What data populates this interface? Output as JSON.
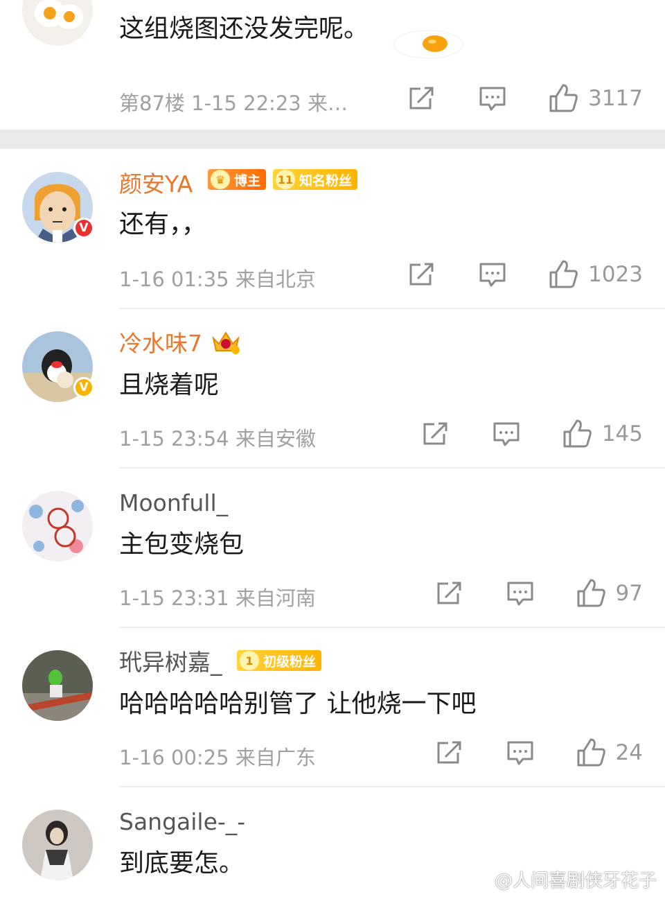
{
  "comments": [
    {
      "text": "这组烧图还没发完呢。",
      "meta": "第87楼 1-15 22:23 来…",
      "likes": "3117"
    },
    {
      "username": "颜安YA",
      "badge_blogger": "博主",
      "badge_fan_level": "11",
      "badge_fan": "知名粉丝",
      "text": "还有，，",
      "meta": "1-16 01:35 来自北京",
      "likes": "1023"
    },
    {
      "username": "冷水味7",
      "text": "且烧着呢",
      "meta": "1-15 23:54 来自安徽",
      "likes": "145"
    },
    {
      "username": "Moonfull_",
      "text": "主包变烧包",
      "meta": "1-15 23:31 来自河南",
      "likes": "97"
    },
    {
      "username": "玳异树嘉_",
      "badge_fan_level": "1",
      "badge_fan": "初级粉丝",
      "text": "哈哈哈哈哈别管了 让他烧一下吧",
      "meta": "1-16 00:25 来自广东",
      "likes": "24"
    },
    {
      "username": "Sangaile-_-",
      "text": "到底要怎。"
    }
  ],
  "watermark": "@人间喜剧侠牙花子",
  "colors": {
    "username_highlight": "#e8762c",
    "verified_red": "#e6322e",
    "verified_gold": "#f5b400",
    "icon_gray": "#8a8a8a"
  }
}
